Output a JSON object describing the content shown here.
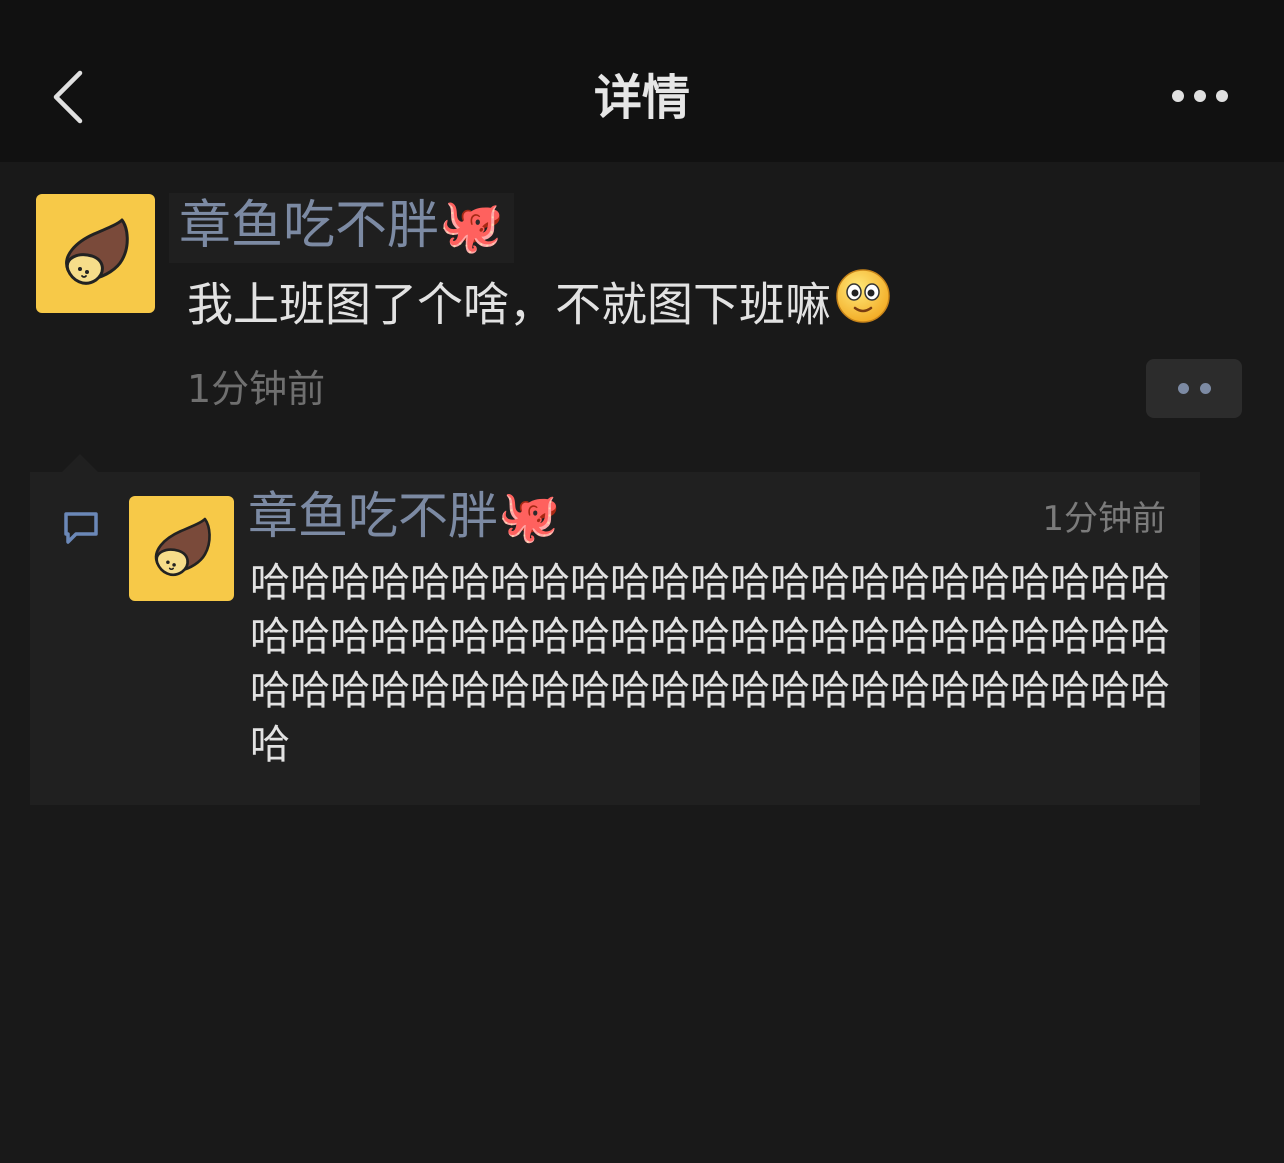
{
  "header": {
    "title": "详情",
    "back_icon": "chevron-left-icon",
    "more_icon": "more-horizontal-icon"
  },
  "post": {
    "author": "章鱼吃不胖🐙",
    "text": "我上班图了个啥，不就图下班嘛",
    "time": "1分钟前",
    "avatar_icon": "sweet-potato-avatar",
    "emoji": "smiley-emoji"
  },
  "comment": {
    "icon": "comment-icon",
    "author": "章鱼吃不胖🐙",
    "time": "1分钟前",
    "text": "哈哈哈哈哈哈哈哈哈哈哈哈哈哈哈哈哈哈哈哈哈哈哈哈哈哈哈哈哈哈哈哈哈哈哈哈哈哈哈哈哈哈哈哈哈哈哈哈哈哈哈哈哈哈哈哈哈哈哈哈哈哈哈哈哈哈哈哈哈哈"
  },
  "colors": {
    "background": "#191919",
    "header": "#111111",
    "name_blue": "#7c8aa3",
    "avatar_yellow": "#f7c948"
  }
}
